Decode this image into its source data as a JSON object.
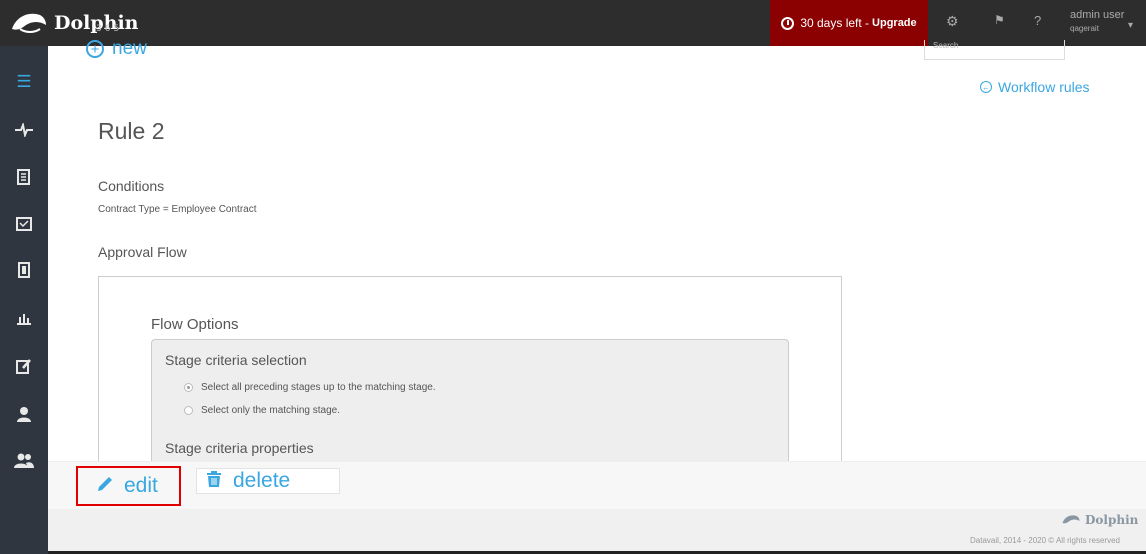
{
  "header": {
    "brand": "Dolphin",
    "brand_sub": "365",
    "trial_text": "30 days left -",
    "upgrade_label": "Upgrade",
    "settings_icon": "gear-icon",
    "flag_icon": "flag-icon",
    "help_label": "?",
    "user_name": "admin user",
    "user_sub": "qagerait"
  },
  "sidebar": {
    "items": [
      {
        "icon": "menu-icon",
        "glyph": "≡"
      },
      {
        "icon": "activity-icon",
        "glyph": "⟡"
      },
      {
        "icon": "documents-icon",
        "glyph": "▤"
      },
      {
        "icon": "inbox-icon",
        "glyph": "✉"
      },
      {
        "icon": "pages-icon",
        "glyph": "▥"
      },
      {
        "icon": "reports-icon",
        "glyph": "▦"
      },
      {
        "icon": "edit-doc-icon",
        "glyph": "✎"
      },
      {
        "icon": "user-icon",
        "glyph": "♟"
      },
      {
        "icon": "users-icon",
        "glyph": "♞"
      }
    ]
  },
  "main": {
    "new_label": "new",
    "search_placeholder": "Search",
    "workflow_rules_label": "Workflow rules",
    "rule_title": "Rule 2",
    "conditions_label": "Conditions",
    "conditions_text": "Contract Type = Employee Contract",
    "approval_flow_label": "Approval Flow",
    "flow_options_label": "Flow Options",
    "stage_criteria_selection_label": "Stage criteria selection",
    "radio_all": "Select all preceding stages up to the matching stage.",
    "radio_only": "Select only the matching stage.",
    "stage_criteria_properties_label": "Stage criteria properties"
  },
  "actions": {
    "edit_label": "edit",
    "delete_label": "delete"
  },
  "footer": {
    "brand": "Dolphin",
    "copyright": "Datavail, 2014 - 2020 © All rights reserved"
  },
  "colors": {
    "accent": "#3aa7e0",
    "trial_bg": "#8b0000",
    "topbar": "#2d2d2d",
    "sidebar": "#2f3640",
    "highlight": "#e00000"
  }
}
